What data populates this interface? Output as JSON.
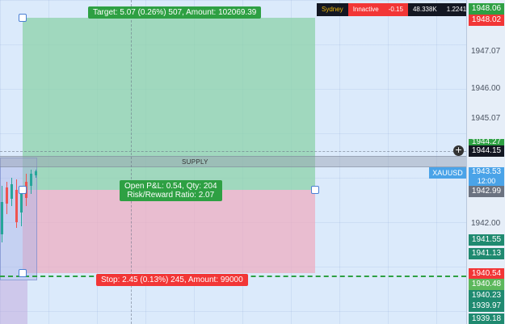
{
  "status": {
    "session": "Sydney",
    "state": "Innactive",
    "change": "-0.15",
    "volume": "48.338K",
    "value": "1.2241"
  },
  "position": {
    "target": "Target: 5.07 (0.26%) 507, Amount: 102069.39",
    "stop": "Stop: 2.45 (0.13%) 245, Amount: 99000",
    "pnl_line1": "Open P&L: 0.54, Qty: 204",
    "pnl_line2": "Risk/Reward Ratio: 2.07"
  },
  "zone_label": "SUPPLY",
  "symbol": "XAUUSD",
  "axis": {
    "ticks": [
      "1947.07",
      "1946.00",
      "1945.07",
      "1942.00",
      "1941.13"
    ],
    "tags": [
      {
        "label": "1948.06",
        "color": "#2ea043"
      },
      {
        "label": "1948.02",
        "color": "#f23636"
      },
      {
        "label": "1944.27",
        "color": "#2ea043"
      },
      {
        "label": "1944.15",
        "color": "#131722"
      },
      {
        "label": "1943.53",
        "color": "#4aa3e8"
      },
      {
        "label": "12:00",
        "color": "#4aa3e8"
      },
      {
        "label": "1942.99",
        "color": "#6b7280"
      },
      {
        "label": "1941.55",
        "color": "#1f8a70"
      },
      {
        "label": "1941.13",
        "color": "#1f8a70"
      },
      {
        "label": "1940.54",
        "color": "#f23636"
      },
      {
        "label": "1940.48",
        "color": "#5cb85c"
      },
      {
        "label": "1940.23",
        "color": "#1f8a70"
      },
      {
        "label": "1939.97",
        "color": "#1f8a70"
      },
      {
        "label": "1939.18",
        "color": "#1f8a70"
      }
    ]
  },
  "colors": {
    "up": "#26a69a",
    "down": "#ef5350",
    "profit": "#2ea043",
    "loss": "#f23636"
  }
}
